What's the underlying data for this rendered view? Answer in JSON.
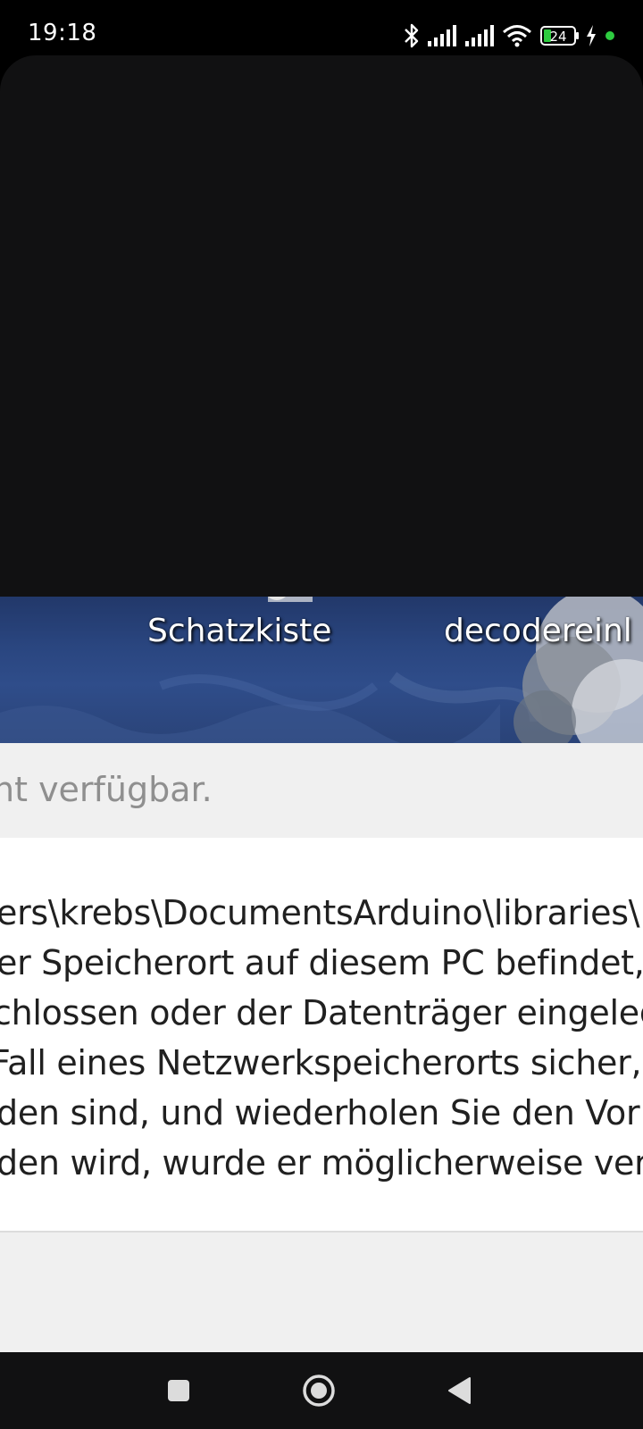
{
  "status_bar": {
    "time": "19:18",
    "battery_level": "24",
    "icons": [
      "bluetooth-icon",
      "signal-icon",
      "signal-icon",
      "wifi-icon",
      "battery-icon",
      "charging-icon",
      "privacy-dot-icon"
    ],
    "privacy_dot_color": "#2ecc40"
  },
  "desktop": {
    "icons": [
      {
        "label": "Schatzkiste"
      },
      {
        "label": "decodereinl"
      }
    ]
  },
  "dialog": {
    "header_text": "ht verfügbar.",
    "message_lines": [
      "ers\\krebs\\DocumentsArduino\\libraries\\",
      "er Speicherort auf diesem PC befindet,",
      "chlossen oder der Datenträger eingeleg",
      " Fall eines Netzwerkspeicherorts sicher,",
      "den sind, und wiederholen Sie den Vor",
      "den wird, wurde er möglicherweise vers"
    ]
  },
  "nav_bar": {
    "buttons": [
      "recents-button",
      "home-button",
      "back-button"
    ]
  }
}
